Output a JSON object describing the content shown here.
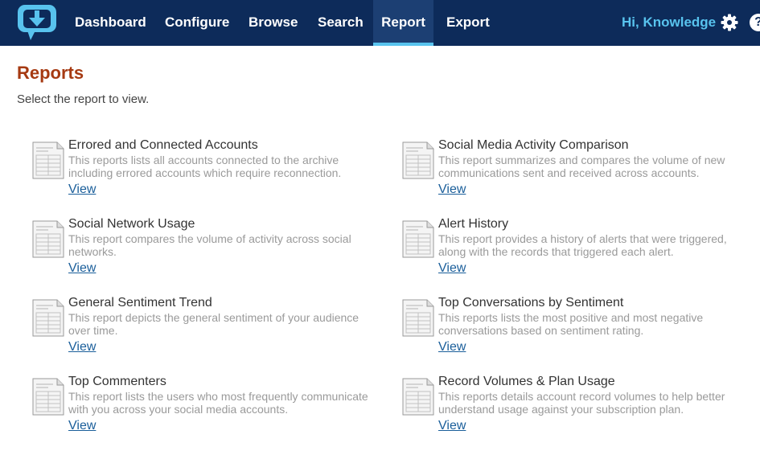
{
  "header": {
    "nav": [
      {
        "label": "Dashboard"
      },
      {
        "label": "Configure"
      },
      {
        "label": "Browse"
      },
      {
        "label": "Search"
      },
      {
        "label": "Report"
      },
      {
        "label": "Export"
      }
    ],
    "active_tab": "Report",
    "greeting": "Hi, Knowledge",
    "help_glyph": "?"
  },
  "page": {
    "title": "Reports",
    "subtitle": "Select the report to view."
  },
  "reports": [
    {
      "title": "Errored and Connected Accounts",
      "description": "This reports lists all accounts connected to the archive including errored accounts which require reconnection.",
      "link": "View"
    },
    {
      "title": "Social Network Usage",
      "description": "This report compares the volume of activity across social networks.",
      "link": "View"
    },
    {
      "title": "General Sentiment Trend",
      "description": "This report depicts the general sentiment of your audience over time.",
      "link": "View"
    },
    {
      "title": "Top Commenters",
      "description": "This report lists the users who most frequently communicate with you across your social media accounts.",
      "link": "View"
    },
    {
      "title": "Social Media Activity Comparison",
      "description": "This report summarizes and compares the volume of new communications sent and received across accounts.",
      "link": "View"
    },
    {
      "title": "Alert History",
      "description": "This report provides a history of alerts that were triggered, along with the records that triggered each alert.",
      "link": "View"
    },
    {
      "title": "Top Conversations by Sentiment",
      "description": "This reports lists the most positive and most negative conversations based on sentiment rating.",
      "link": "View"
    },
    {
      "title": "Record Volumes & Plan Usage",
      "description": "This reports details account record volumes to help better understand usage against your subscription plan.",
      "link": "View"
    }
  ],
  "colors": {
    "header_bg": "#0d2b5a",
    "accent": "#58c3ee",
    "title": "#a63a12",
    "link": "#1a5e9a"
  },
  "icons": {
    "logo": "download-speech-bubble-icon",
    "settings": "gear-icon",
    "help": "help-icon",
    "report": "document-icon"
  }
}
